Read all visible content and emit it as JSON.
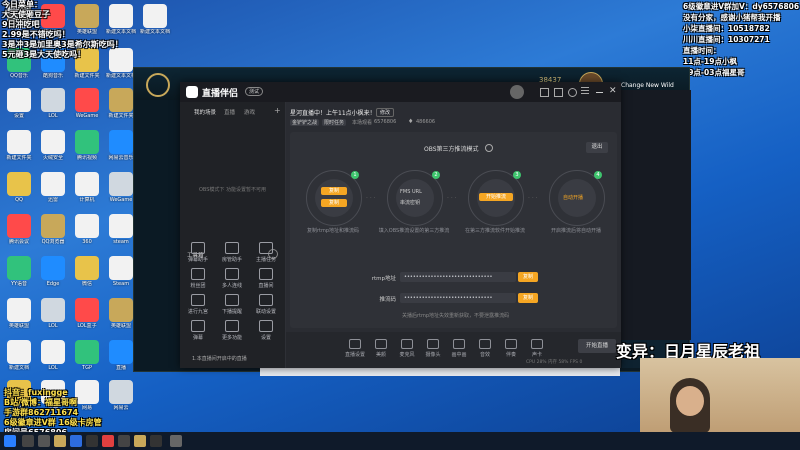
{
  "overlay_top_left": [
    "今日菜单：",
    "大天使砸豆子",
    "9日冲吃吧",
    "2.99是不错吃吗！",
    "3是冲3是加里奥3是希尔斯吃吗！",
    "5元砸3是大天使吃吗！"
  ],
  "overlay_top_right": {
    "line1": "6级徽章进V群加V：dy6576806",
    "line2": "没有分家，感谢小猪帮我开播",
    "line3_label": "小柒直播间：",
    "line3_value": "10518782",
    "line4_label": "川川直播间：",
    "line4_value": "10307271",
    "line5": "直播时间：",
    "line6": "11点-19点小枫",
    "line7": "19点-03点福星哥"
  },
  "overlay_bottom_left": [
    "抖音：fuxingge",
    "B站/微博：福星哥啊",
    "手游群862711674",
    "6级徽章进V群 16级卡房管",
    "房间号6576806"
  ],
  "overlay_variant": "变异：日月星辰老祖",
  "game": {
    "points": "38437",
    "side_text": "Change New Wild"
  },
  "app": {
    "brand": "直播伴侣",
    "brand_badge": "测试",
    "tabs": [
      "我的场景",
      "直播",
      "游戏"
    ],
    "empty_hint": "OBS模式下 功能设置暂不可用",
    "toolbox_title": "工具箱",
    "tools": [
      "弹幕助手",
      "房管助手",
      "主播任务",
      "粉丝团",
      "多人连线",
      "直播间",
      "进行九宫",
      "下播提醒",
      "联动设置",
      "弹幕",
      "更多功能",
      "设置"
    ],
    "room_title": "星河直播中！上午11点小枫来！",
    "edit_label": "修改",
    "tag1": "金铲铲之战",
    "tag2": "限时任务",
    "fans_label": "本场观看",
    "fans_value": "6576806",
    "like_value": "486606",
    "mode_title": "OBS第三方推流模式",
    "exit_label": "退出",
    "step1_btn1": "复制",
    "step1_btn2": "复制",
    "step1_caption": "复制rtmp地址和推流码",
    "step2_l1": "FMS URL",
    "step2_l2": "串流密钥",
    "step2_caption": "填入OBS推流设置的第三方推流",
    "step3_btn": "开始推流",
    "step3_caption": "在第三方推流软件开始推流",
    "step4_l1": "自动开播",
    "step4_caption": "开启推流后将自动开播",
    "rtmp_label": "rtmp地址",
    "rtmp_value": "••••••••••••••••••••••••••••••",
    "key_label": "推流码",
    "key_value": "••••••••••••••••••••••••••••••",
    "copy_label": "复制",
    "notice": "关播后rtmp地址失效重新获取，不要泄露推流码",
    "bottom_tools": [
      "直播设置",
      "美颜",
      "麦克风",
      "摄像头",
      "画中画",
      "音效",
      "伴奏",
      "声卡"
    ],
    "start_label": "开始直播",
    "footer_text": "1.本直播间开启中的直播",
    "stats": "CPU 28%  内存 58%  FPS 0"
  },
  "desktop_icons": [
    "回收站",
    "直播伴侣",
    "英雄联盟",
    "新建文本文档",
    "新建文本文档",
    "QQ音乐",
    "酷狗音乐",
    "新建文件夹",
    "新建文本文档",
    "设置",
    "LOL",
    "WeGame",
    "新建文件夹",
    "新建文件夹",
    "火绒安全",
    "腾讯视频",
    "网易云音乐",
    "QQ",
    "迅雷",
    "计算机",
    "WeGame",
    "腾讯会议",
    "QQ浏览器",
    "360",
    "steam",
    "YY语音",
    "Edge",
    "微信",
    "Steam",
    "英雄联盟",
    "LOL",
    "LOL盒子",
    "英雄联盟",
    "新建文档",
    "LOL",
    "TGP",
    "直播",
    "酷狗",
    "雷神",
    "网易",
    "网易云",
    "直播伴侣"
  ]
}
